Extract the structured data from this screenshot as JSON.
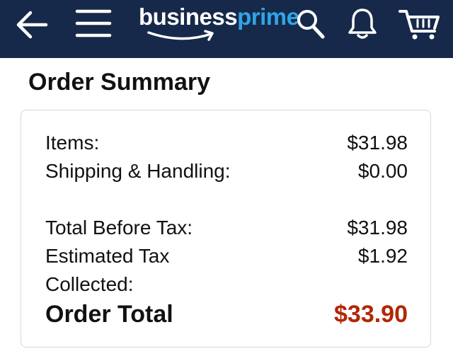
{
  "header": {
    "logo_business": "business",
    "logo_prime": "prime",
    "icons": [
      "back-arrow-icon",
      "hamburger-menu-icon",
      "search-icon",
      "bell-icon",
      "cart-icon"
    ],
    "background_color": "#17294a",
    "prime_color": "#2ea6e6"
  },
  "order_summary": {
    "title": "Order Summary",
    "items_label": "Items:",
    "items_value": "$31.98",
    "shipping_label": "Shipping & Handling:",
    "shipping_value": "$0.00",
    "before_tax_label": "Total Before Tax:",
    "before_tax_value": "$31.98",
    "tax_label": "Estimated Tax Collected:",
    "tax_value": "$1.92",
    "total_label": "Order Total",
    "total_value": "$33.90",
    "total_color": "#b12704"
  }
}
